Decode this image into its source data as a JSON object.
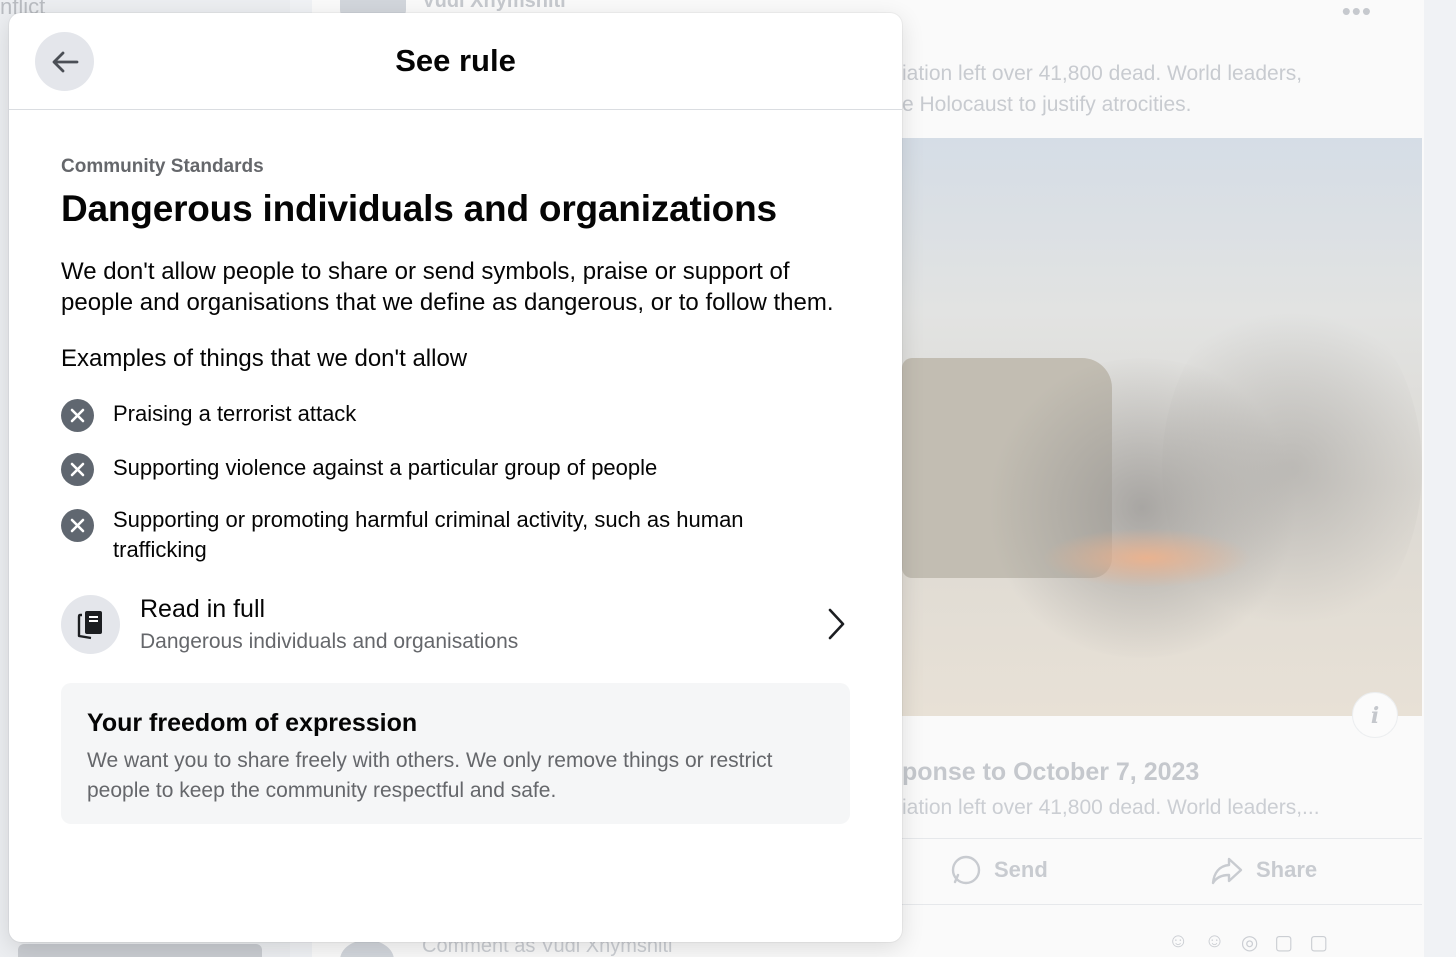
{
  "background": {
    "left_snippet": "nflict",
    "author_name": "Vudi Xhymshiti",
    "caption_line1": "iation left over 41,800 dead. World leaders,",
    "caption_line2": "e Holocaust to justify atrocities.",
    "link_title": "ponse to October 7, 2023",
    "link_desc": "iation left over 41,800 dead. World leaders,...",
    "action_send": "Send",
    "action_share": "Share",
    "comment_placeholder": "Comment as Vudi Xhymshiti"
  },
  "modal": {
    "title": "See rule",
    "eyebrow": "Community Standards",
    "rule_title": "Dangerous individuals and organizations",
    "rule_description": "We don't allow people to share or send symbols, praise or support of people and organisations that we define as dangerous, or to follow them.",
    "examples_heading": "Examples of things that we don't allow",
    "examples": [
      "Praising a terrorist attack",
      "Supporting violence against a particular group of people",
      "Supporting or promoting harmful criminal activity, such as human trafficking"
    ],
    "read_full": {
      "title": "Read in full",
      "subtitle": "Dangerous individuals and organisations"
    },
    "freedom": {
      "title": "Your freedom of expression",
      "text": "We want you to share freely with others. We only remove things or restrict people to keep the community respectful and safe."
    }
  },
  "icons": {
    "back": "arrow-left-icon",
    "not_allowed": "x-circle-icon",
    "read_full": "book-icon",
    "chevron": "chevron-right-icon",
    "info": "info-icon"
  },
  "colors": {
    "icon_bg": "#e4e6eb",
    "x_icon": "#606770",
    "secondary_text": "#65676b",
    "card_bg": "#f5f6f7"
  }
}
